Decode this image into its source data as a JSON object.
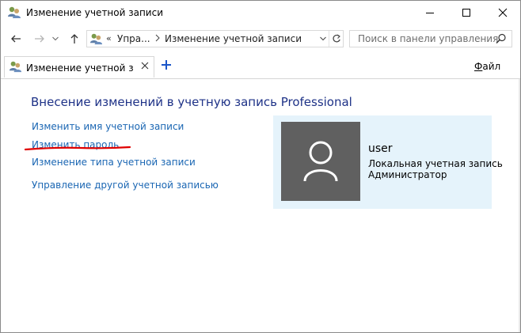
{
  "window": {
    "title": "Изменение учетной записи",
    "icon": "user-accounts-icon"
  },
  "address_bar": {
    "overflow_chevron": "«",
    "crumbs": [
      "Упра...",
      "Изменение учетной записи"
    ]
  },
  "search": {
    "placeholder": "Поиск в панели управления"
  },
  "tab": {
    "label": "Изменение учетной запи",
    "add_symbol": "+"
  },
  "menu": {
    "file_underlined": "Ф",
    "file_rest": "айл"
  },
  "main": {
    "heading": "Внесение изменений в учетную запись Professional",
    "links": [
      "Изменить имя учетной записи",
      "Изменить пароль",
      "Изменение типа учетной записи",
      "Управление другой учетной записью"
    ]
  },
  "user_card": {
    "name": "user",
    "account_type": "Локальная учетная запись",
    "role": "Администратор"
  },
  "colors": {
    "heading": "#1e3287",
    "link": "#1a66b3",
    "card_bg": "#e5f3fb",
    "avatar_bg": "#606060",
    "annotation_underline": "#e00000"
  }
}
